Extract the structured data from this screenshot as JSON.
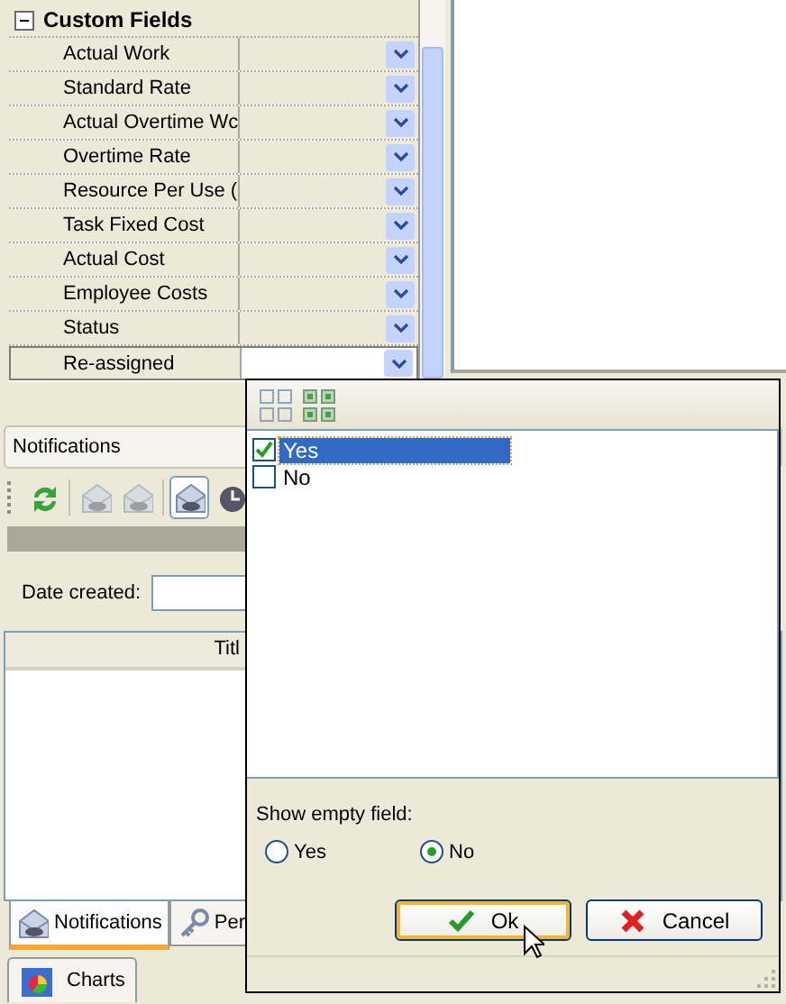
{
  "property_grid": {
    "category": {
      "label": "Custom Fields",
      "expanded": true
    },
    "rows": [
      {
        "name": "Actual Work",
        "selected": false
      },
      {
        "name": "Standard Rate",
        "selected": false
      },
      {
        "name": "Actual Overtime Wc",
        "selected": false
      },
      {
        "name": "Overtime Rate",
        "selected": false
      },
      {
        "name": "Resource Per Use (",
        "selected": false
      },
      {
        "name": "Task Fixed Cost",
        "selected": false
      },
      {
        "name": "Actual Cost",
        "selected": false
      },
      {
        "name": "Employee Costs",
        "selected": false
      },
      {
        "name": "Status",
        "selected": false
      },
      {
        "name": "Re-assigned",
        "selected": true
      }
    ]
  },
  "notifications_panel": {
    "title": "Notifications",
    "toolbar": [
      {
        "kind": "refresh",
        "disabled": false,
        "pressed": false
      },
      {
        "kind": "envelope",
        "disabled": true,
        "pressed": false
      },
      {
        "kind": "envelope",
        "disabled": true,
        "pressed": false
      },
      {
        "kind": "envelope",
        "disabled": false,
        "pressed": true
      },
      {
        "kind": "clock",
        "disabled": false,
        "pressed": false
      }
    ],
    "date_created": {
      "label": "Date created:"
    },
    "table": {
      "columns": [
        "Titl"
      ]
    },
    "tabs": [
      {
        "label": "Notifications",
        "kind": "envelope",
        "selected": true
      },
      {
        "label": "Per",
        "kind": "key",
        "selected": false
      }
    ]
  },
  "bottom_tabs": [
    {
      "label": "Charts",
      "kind": "chart",
      "selected": false
    }
  ],
  "filter_popup": {
    "options": [
      {
        "label": "Yes",
        "checked": true,
        "selected": true
      },
      {
        "label": "No",
        "checked": false,
        "selected": false
      }
    ],
    "show_empty": {
      "label": "Show empty field:",
      "options": [
        {
          "label": "Yes",
          "selected": false
        },
        {
          "label": "No",
          "selected": true
        }
      ]
    },
    "buttons": [
      {
        "label": "Ok",
        "kind": "ok",
        "focused": true
      },
      {
        "label": "Cancel",
        "kind": "cancel",
        "focused": false
      }
    ]
  }
}
